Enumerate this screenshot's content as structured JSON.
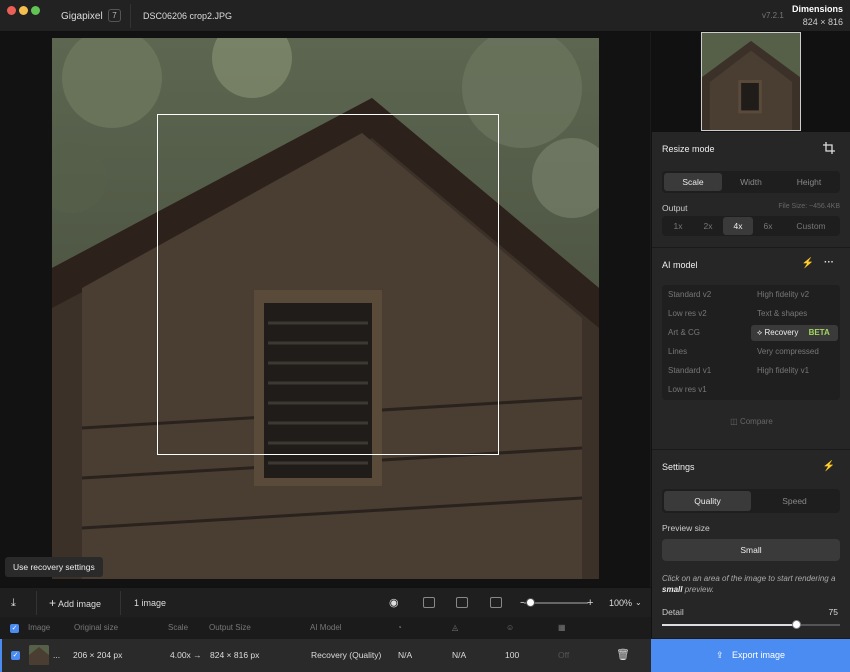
{
  "titlebar": {
    "app_name": "Gigapixel",
    "app_badge": "7",
    "file_name": "DSC06206 crop2.JPG",
    "version": "v7.2.1",
    "dimensions_label": "Dimensions",
    "dimensions_value": "824 × 816"
  },
  "canvas": {
    "tooltip": "Use recovery settings"
  },
  "resize": {
    "title": "Resize mode",
    "modes": [
      "Scale",
      "Width",
      "Height"
    ],
    "active_mode": "Scale",
    "output_label": "Output",
    "file_size": "File Size: ~456.4KB",
    "scales": [
      "1x",
      "2x",
      "4x",
      "6x",
      "Custom"
    ],
    "active_scale": "4x"
  },
  "ai_model": {
    "title": "AI model",
    "left_models": [
      "Standard v2",
      "Low res v2",
      "Art & CG",
      "Lines",
      "Standard v1",
      "Low res v1"
    ],
    "right_models": [
      "High fidelity v2",
      "Text & shapes",
      "Recovery",
      "Very compressed",
      "High fidelity v1"
    ],
    "active_model": "Recovery",
    "beta": "BETA",
    "compare": "Compare"
  },
  "settings": {
    "title": "Settings",
    "modes": [
      "Quality",
      "Speed"
    ],
    "active_mode": "Quality",
    "preview_label": "Preview size",
    "preview_value": "Small",
    "hint_pre": "Click on an area of the image to start rendering a ",
    "hint_bold": "small",
    "hint_post": " preview.",
    "detail_label": "Detail",
    "detail_value": "75",
    "detail_fraction": 0.75
  },
  "export_label": "Export image",
  "toolbar": {
    "add_image": "Add image",
    "image_count": "1 image",
    "zoom": "100%",
    "zoom_fraction": 0.1
  },
  "table": {
    "headers": {
      "image": "Image",
      "original": "Original size",
      "scale": "Scale",
      "output": "Output Size",
      "model": "AI Model"
    },
    "row": {
      "name": "...",
      "original": "206 × 204 px",
      "scale": "4.00x →",
      "output": "824 × 816 px",
      "model": "Recovery (Quality)",
      "col1": "N/A",
      "col2": "N/A",
      "col3": "100",
      "col4": "Off"
    }
  },
  "colors": {
    "accent": "#4a8cf2",
    "beta": "#a4d65e"
  }
}
